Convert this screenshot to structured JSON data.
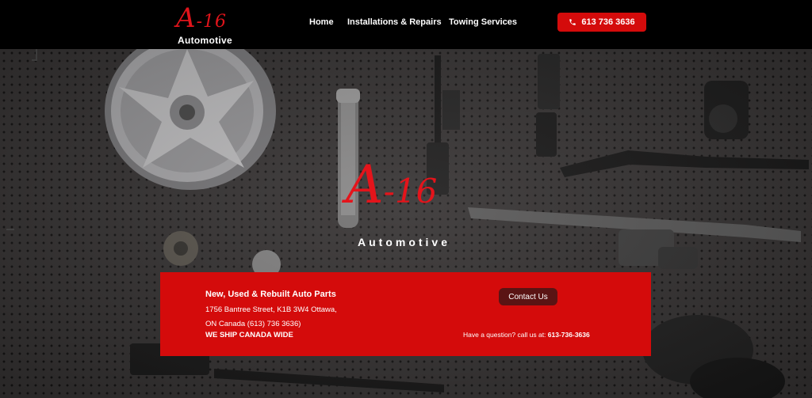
{
  "brand": {
    "logo_mark": "A-16",
    "logo_sub": "Automotive"
  },
  "nav": {
    "home": "Home",
    "installations": "Installations & Repairs",
    "towing": "Towing Services"
  },
  "phone_button": {
    "label": "613 736 3636",
    "icon": "phone-icon"
  },
  "hero": {
    "logo_mark": "A-16",
    "logo_sub": "Automotive"
  },
  "info": {
    "title": "New, Used & Rebuilt Auto Parts",
    "address_line1": "1756 Bantree Street, K1B 3W4 Ottawa,",
    "address_line2": "ON Canada (613) 736 3636)",
    "shipping": "WE SHIP CANADA WIDE",
    "contact_button": "Contact Us",
    "question_text": "Have a question? call us at: ",
    "question_phone": "613-736-3636"
  },
  "colors": {
    "brand_red": "#d40b0b",
    "logo_red": "#e0141b",
    "header_bg": "#000000",
    "contact_btn": "#5a1414"
  }
}
